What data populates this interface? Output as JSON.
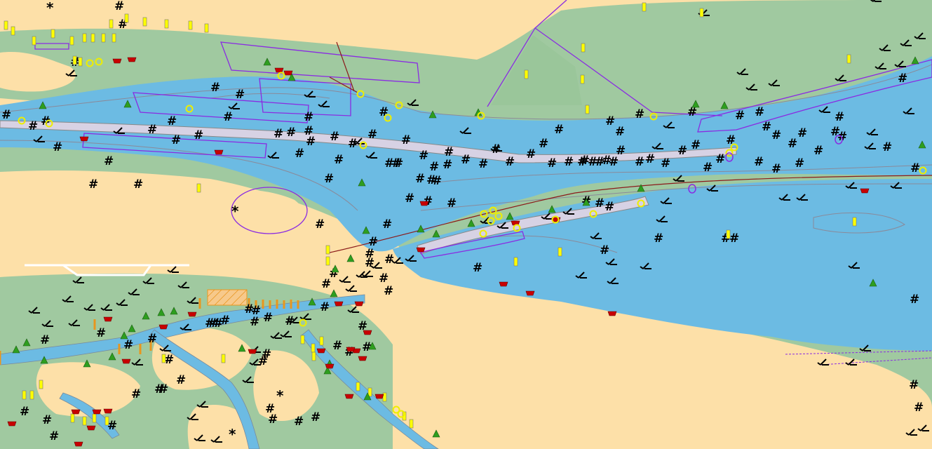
{
  "map": {
    "type": "nautical-chart",
    "colors": {
      "land": "#fde0a8",
      "intertidal": "#a0c9a0",
      "deep_water": "#6cbbe3",
      "shallow_water": "#93cdea",
      "fairway": "#d7d2e4",
      "restricted_line": "#8a2be2",
      "cable_line": "#8b1a1a",
      "depth_contour": "#8a8a9a",
      "buoy_green": "#2e9e1f",
      "buoy_red": "#c80000",
      "beacon_yellow": "#ffff00",
      "buoy_orange": "#e8961e"
    },
    "legend_symbols": {
      "wreck": "wreck-icon",
      "obstruction": "obstruction-icon",
      "rock": "rock-icon",
      "light": "light-icon",
      "anchorage": "anchorage-icon"
    },
    "wreck_glyph": "#",
    "rock_glyph": "*"
  }
}
